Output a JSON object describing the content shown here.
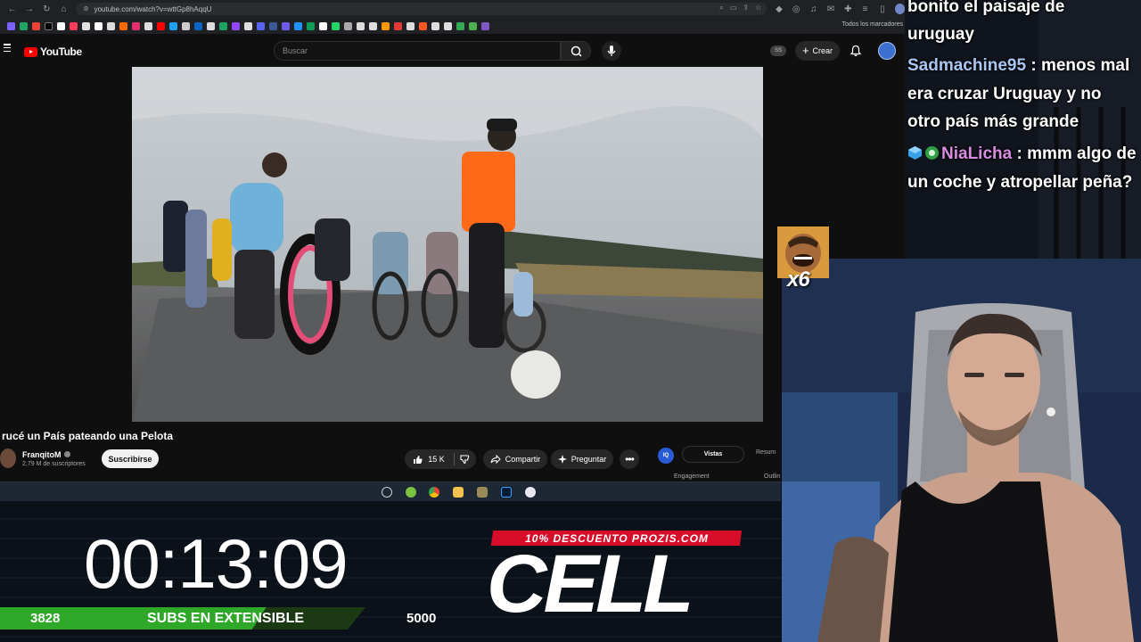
{
  "browser": {
    "url": "youtube.com/watch?v=wttGp8hAqqU",
    "all_bookmarks_label": "Todos los marcadores"
  },
  "youtube": {
    "logo_text": "YouTube",
    "search": {
      "placeholder": "Buscar"
    },
    "ss_badge": "SS",
    "create_label": "Crear",
    "video": {
      "title": "rucé un País pateando una Pelota",
      "channel": "FranqitoM",
      "subscribers": "2,79 M de suscriptores",
      "subscribe_label": "Suscribirse",
      "likes": "15 K",
      "share_label": "Compartir",
      "ask_label": "Preguntar",
      "more_label": "•••"
    },
    "side_panel": {
      "logo": "IQ",
      "tab_active": "Vistas",
      "tab_summary": "Resum",
      "tab_engagement": "Engagement",
      "tab_outline": "Outlin"
    }
  },
  "overlay": {
    "timer": "00:13:09",
    "subs_current": "3828",
    "subs_label": "SUBS EN EXTENSIBLE",
    "subs_goal": "5000",
    "subs_progress": 0.766,
    "promo_text": "10% DESCUENTO PROZIS.COM",
    "sponsor_logo": "CELL"
  },
  "chat": {
    "messages": [
      {
        "user": "",
        "text": "bonito el paisaje de"
      },
      {
        "user": "",
        "text": "uruguay"
      },
      {
        "user": "Sadmachine95",
        "sep": " : ",
        "text": "menos mal era cruzar Uruguay y no otro país más grande"
      },
      {
        "user": "NiaLicha",
        "sep": " : ",
        "text": "mmm algo de un coche y atropellar peña?"
      }
    ],
    "emote_count": "x6"
  },
  "colors": {
    "yt_red": "#ff0000",
    "subs_bar_green": "#2fa82a",
    "promo_red": "#d80d2a",
    "user_blue": "#a9c6f2",
    "user_pink": "#d88ce0"
  }
}
